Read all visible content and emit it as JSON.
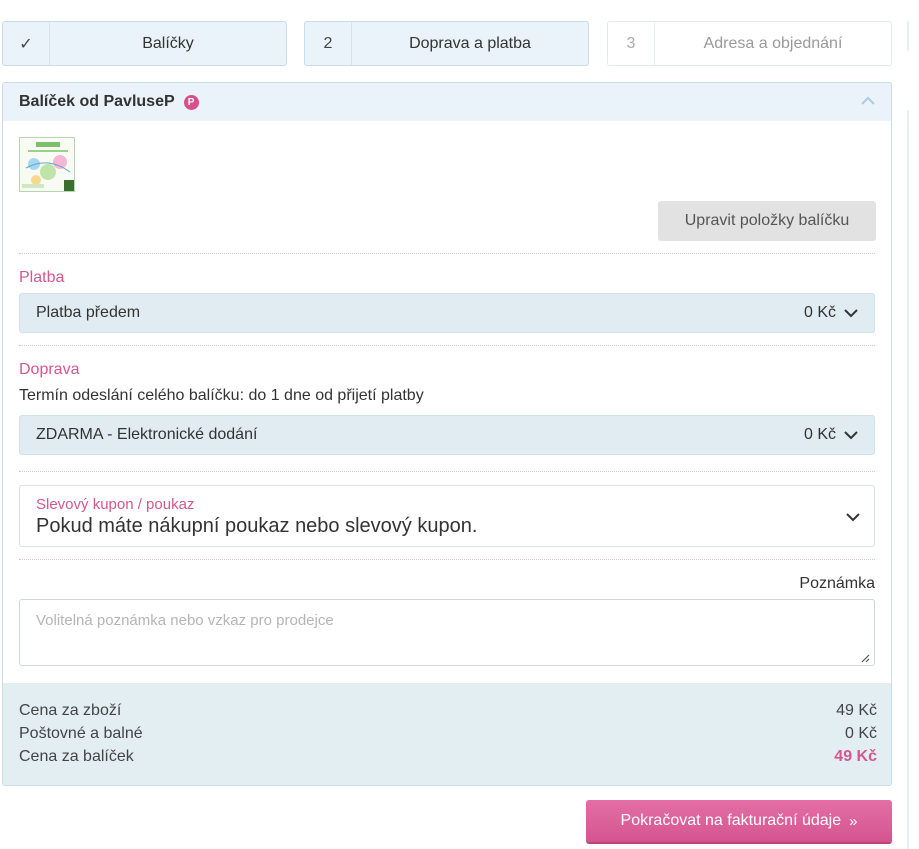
{
  "steps": [
    {
      "marker": "✓",
      "label": "Balíčky",
      "state": "done"
    },
    {
      "marker": "2",
      "label": "Doprava a platba",
      "state": "active"
    },
    {
      "marker": "3",
      "label": "Adresa a objednání",
      "state": "todo"
    }
  ],
  "package": {
    "title": "Balíček od PavluseP",
    "seller_badge": "P",
    "edit_button": "Upravit položky balíčku"
  },
  "payment": {
    "label": "Platba",
    "selected": "Platba předem",
    "price": "0 Kč"
  },
  "shipping": {
    "label": "Doprava",
    "note": "Termín odeslání celého balíčku: do 1 dne od přijetí platby",
    "selected": "ZDARMA - Elektronické dodání",
    "price": "0 Kč"
  },
  "coupon": {
    "label": "Slevový kupon / poukaz",
    "value": "Pokud máte nákupní poukaz nebo slevový kupon."
  },
  "note": {
    "label": "Poznámka",
    "placeholder": "Volitelná poznámka nebo vzkaz pro prodejce"
  },
  "summary": {
    "goods_label": "Cena za zboží",
    "goods_value": "49 Kč",
    "shipping_label": "Poštovné a balné",
    "shipping_value": "0 Kč",
    "total_label": "Cena za balíček",
    "total_value": "49 Kč"
  },
  "continue_button": "Pokračovat na fakturační údaje",
  "colors": {
    "accent": "#d4578f",
    "step_bg": "#e9f3f9",
    "select_bg": "#e0ecf1",
    "summary_bg": "#e3eef3"
  }
}
